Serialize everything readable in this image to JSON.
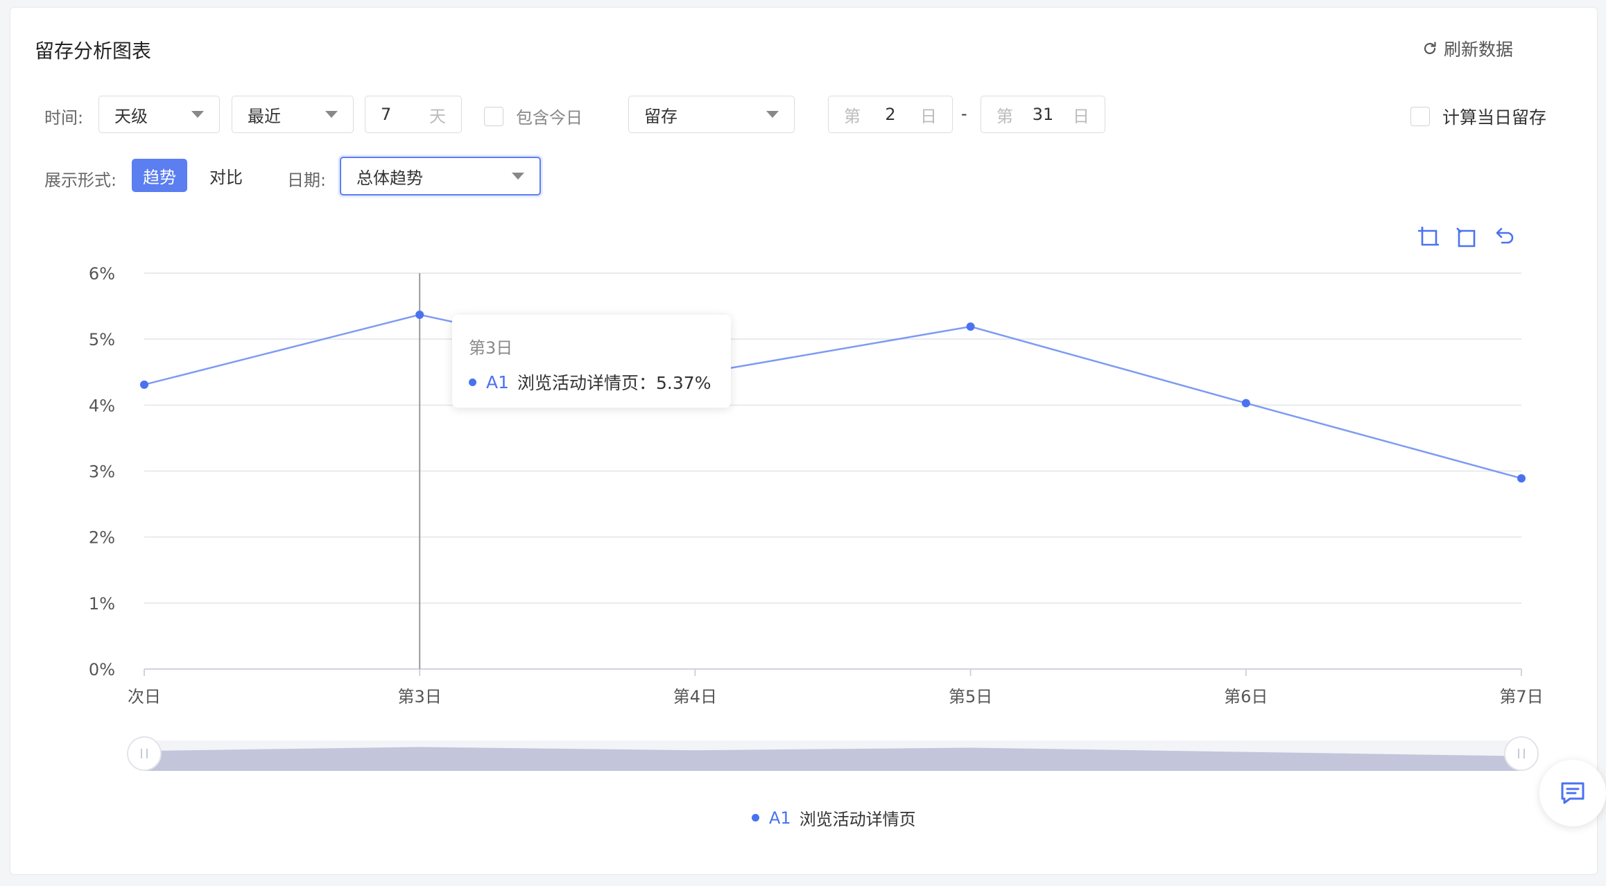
{
  "header": {
    "title": "留存分析图表",
    "refresh_label": "刷新数据"
  },
  "filters": {
    "time_label": "时间:",
    "granularity": "天级",
    "range_mode": "最近",
    "days_value": "7",
    "days_unit": "天",
    "include_today_label": "包含今日",
    "metric": "留存",
    "from_prefix": "第",
    "from_value": "2",
    "from_suffix": "日",
    "dash": "-",
    "to_prefix": "第",
    "to_value": "31",
    "to_suffix": "日",
    "same_day_label": "计算当日留存"
  },
  "display": {
    "form_label": "展示形式:",
    "trend_label": "趋势",
    "compare_label": "对比",
    "date_label": "日期:",
    "date_select": "总体趋势"
  },
  "tooltip": {
    "title": "第3日",
    "series_tag": "A1",
    "series_name": "浏览活动详情页",
    "value": "：5.37%"
  },
  "legend": {
    "tag": "A1",
    "name": "浏览活动详情页"
  },
  "colors": {
    "accent": "#5b7ef0",
    "series": "#4a72f0",
    "line": "#7d9bf3"
  },
  "chart_data": {
    "type": "line",
    "categories": [
      "次日",
      "第3日",
      "第4日",
      "第5日",
      "第6日",
      "第7日"
    ],
    "series": [
      {
        "name": "A1 浏览活动详情页",
        "values": [
          4.31,
          5.37,
          4.47,
          5.19,
          4.03,
          2.89
        ]
      }
    ],
    "y_ticks": [
      "0%",
      "1%",
      "2%",
      "3%",
      "4%",
      "5%",
      "6%"
    ],
    "ylim": [
      0,
      6
    ],
    "grid": true,
    "highlighted_category": "第3日",
    "legend_position": "bottom-center"
  }
}
